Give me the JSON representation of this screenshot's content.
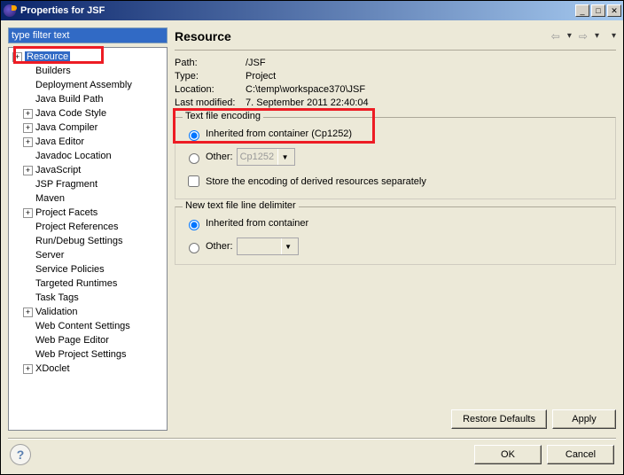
{
  "title": "Properties for JSF",
  "filter": {
    "value": "type filter text"
  },
  "tree": {
    "items": [
      {
        "label": "Resource",
        "expand": true,
        "selected": true
      },
      {
        "label": "Builders",
        "expand": false,
        "indent": true
      },
      {
        "label": "Deployment Assembly",
        "expand": false,
        "indent": true
      },
      {
        "label": "Java Build Path",
        "expand": false,
        "indent": true
      },
      {
        "label": "Java Code Style",
        "expand": true,
        "indent": true
      },
      {
        "label": "Java Compiler",
        "expand": true,
        "indent": true
      },
      {
        "label": "Java Editor",
        "expand": true,
        "indent": true
      },
      {
        "label": "Javadoc Location",
        "expand": false,
        "indent": true
      },
      {
        "label": "JavaScript",
        "expand": true,
        "indent": true
      },
      {
        "label": "JSP Fragment",
        "expand": false,
        "indent": true
      },
      {
        "label": "Maven",
        "expand": false,
        "indent": true
      },
      {
        "label": "Project Facets",
        "expand": true,
        "indent": true
      },
      {
        "label": "Project References",
        "expand": false,
        "indent": true
      },
      {
        "label": "Run/Debug Settings",
        "expand": false,
        "indent": true
      },
      {
        "label": "Server",
        "expand": false,
        "indent": true
      },
      {
        "label": "Service Policies",
        "expand": false,
        "indent": true
      },
      {
        "label": "Targeted Runtimes",
        "expand": false,
        "indent": true
      },
      {
        "label": "Task Tags",
        "expand": false,
        "indent": true
      },
      {
        "label": "Validation",
        "expand": true,
        "indent": true
      },
      {
        "label": "Web Content Settings",
        "expand": false,
        "indent": true
      },
      {
        "label": "Web Page Editor",
        "expand": false,
        "indent": true
      },
      {
        "label": "Web Project Settings",
        "expand": false,
        "indent": true
      },
      {
        "label": "XDoclet",
        "expand": true,
        "indent": true
      }
    ]
  },
  "header": {
    "title": "Resource"
  },
  "info": {
    "path_label": "Path:",
    "path_value": "/JSF",
    "type_label": "Type:",
    "type_value": "Project",
    "location_label": "Location:",
    "location_value": "C:\\temp\\workspace370\\JSF",
    "modified_label": "Last modified:",
    "modified_value": "7. September 2011 22:40:04"
  },
  "encoding": {
    "legend": "Text file encoding",
    "inherited_label": "Inherited from container (Cp1252)",
    "other_label": "Other:",
    "other_value": "Cp1252",
    "derived_label": "Store the encoding of derived resources separately"
  },
  "delimiter": {
    "legend": "New text file line delimiter",
    "inherited_label": "Inherited from container",
    "other_label": "Other:"
  },
  "buttons": {
    "restore": "Restore Defaults",
    "apply": "Apply",
    "ok": "OK",
    "cancel": "Cancel"
  }
}
